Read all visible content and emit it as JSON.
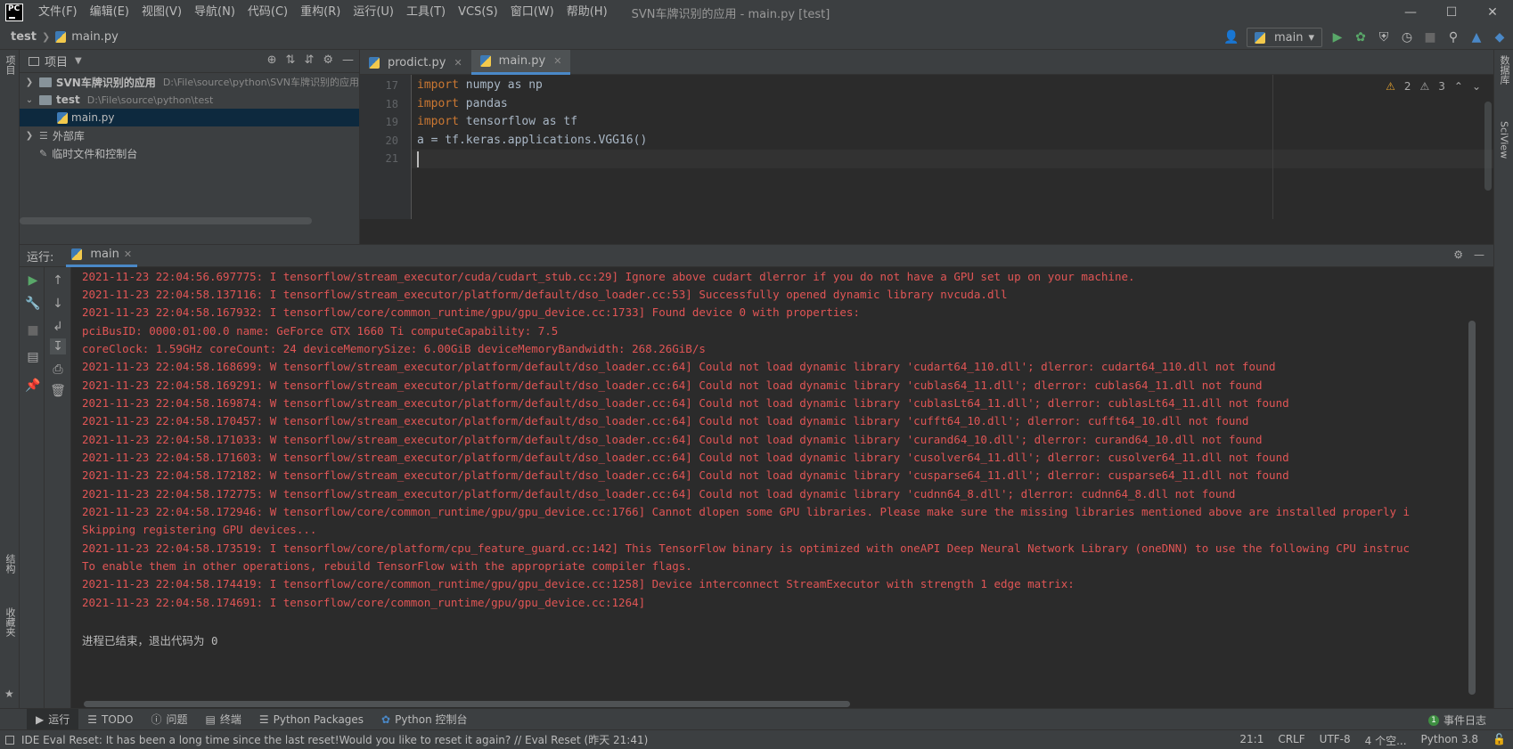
{
  "titlebar": {
    "logo": "PC",
    "menus": [
      "文件(F)",
      "编辑(E)",
      "视图(V)",
      "导航(N)",
      "代码(C)",
      "重构(R)",
      "运行(U)",
      "工具(T)",
      "VCS(S)",
      "窗口(W)",
      "帮助(H)"
    ],
    "window_title": "SVN车牌识别的应用 - main.py [test]"
  },
  "navbar": {
    "crumb_project": "test",
    "crumb_file": "main.py",
    "run_config": "main"
  },
  "left_strip": {
    "project_tab": "项目",
    "structure_tab": "结构",
    "favorites_tab": "收藏夹"
  },
  "right_strip": {
    "database_tab": "数据库",
    "sciview_tab": "SciView"
  },
  "project_panel": {
    "title": "项目",
    "tree": [
      {
        "name": "SVN车牌识别的应用",
        "path": "D:\\File\\source\\python\\SVN车牌识别的应用"
      },
      {
        "name": "test",
        "path": "D:\\File\\source\\python\\test"
      },
      {
        "name": "main.py"
      },
      {
        "name": "外部库"
      },
      {
        "name": "临时文件和控制台"
      }
    ]
  },
  "editor": {
    "tabs": [
      {
        "label": "prodict.py"
      },
      {
        "label": "main.py"
      }
    ],
    "lines": [
      {
        "num": "17",
        "kw": "import",
        "rest": " numpy as np"
      },
      {
        "num": "18",
        "kw": "import",
        "rest": " pandas"
      },
      {
        "num": "19",
        "kw": "import",
        "rest": " tensorflow as tf"
      },
      {
        "num": "20",
        "kw": "",
        "rest": "a = tf.keras.applications.VGG16()"
      },
      {
        "num": "21",
        "kw": "",
        "rest": ""
      }
    ],
    "warnings": "2",
    "weak_warnings": "3"
  },
  "run_panel": {
    "label": "运行:",
    "tab": "main"
  },
  "console": {
    "lines": [
      "2021-11-23 22:04:56.697775: I tensorflow/stream_executor/cuda/cudart_stub.cc:29] Ignore above cudart dlerror if you do not have a GPU set up on your machine.",
      "2021-11-23 22:04:58.137116: I tensorflow/stream_executor/platform/default/dso_loader.cc:53] Successfully opened dynamic library nvcuda.dll",
      "2021-11-23 22:04:58.167932: I tensorflow/core/common_runtime/gpu/gpu_device.cc:1733] Found device 0 with properties:",
      "pciBusID: 0000:01:00.0 name: GeForce GTX 1660 Ti computeCapability: 7.5",
      "coreClock: 1.59GHz coreCount: 24 deviceMemorySize: 6.00GiB deviceMemoryBandwidth: 268.26GiB/s",
      "2021-11-23 22:04:58.168699: W tensorflow/stream_executor/platform/default/dso_loader.cc:64] Could not load dynamic library 'cudart64_110.dll'; dlerror: cudart64_110.dll not found",
      "2021-11-23 22:04:58.169291: W tensorflow/stream_executor/platform/default/dso_loader.cc:64] Could not load dynamic library 'cublas64_11.dll'; dlerror: cublas64_11.dll not found",
      "2021-11-23 22:04:58.169874: W tensorflow/stream_executor/platform/default/dso_loader.cc:64] Could not load dynamic library 'cublasLt64_11.dll'; dlerror: cublasLt64_11.dll not found",
      "2021-11-23 22:04:58.170457: W tensorflow/stream_executor/platform/default/dso_loader.cc:64] Could not load dynamic library 'cufft64_10.dll'; dlerror: cufft64_10.dll not found",
      "2021-11-23 22:04:58.171033: W tensorflow/stream_executor/platform/default/dso_loader.cc:64] Could not load dynamic library 'curand64_10.dll'; dlerror: curand64_10.dll not found",
      "2021-11-23 22:04:58.171603: W tensorflow/stream_executor/platform/default/dso_loader.cc:64] Could not load dynamic library 'cusolver64_11.dll'; dlerror: cusolver64_11.dll not found",
      "2021-11-23 22:04:58.172182: W tensorflow/stream_executor/platform/default/dso_loader.cc:64] Could not load dynamic library 'cusparse64_11.dll'; dlerror: cusparse64_11.dll not found",
      "2021-11-23 22:04:58.172775: W tensorflow/stream_executor/platform/default/dso_loader.cc:64] Could not load dynamic library 'cudnn64_8.dll'; dlerror: cudnn64_8.dll not found",
      "2021-11-23 22:04:58.172946: W tensorflow/core/common_runtime/gpu/gpu_device.cc:1766] Cannot dlopen some GPU libraries. Please make sure the missing libraries mentioned above are installed properly i",
      "Skipping registering GPU devices...",
      "2021-11-23 22:04:58.173519: I tensorflow/core/platform/cpu_feature_guard.cc:142] This TensorFlow binary is optimized with oneAPI Deep Neural Network Library (oneDNN) to use the following CPU instruc",
      "To enable them in other operations, rebuild TensorFlow with the appropriate compiler flags.",
      "2021-11-23 22:04:58.174419: I tensorflow/core/common_runtime/gpu/gpu_device.cc:1258] Device interconnect StreamExecutor with strength 1 edge matrix:",
      "2021-11-23 22:04:58.174691: I tensorflow/core/common_runtime/gpu/gpu_device.cc:1264]"
    ],
    "exit_message": "进程已结束，退出代码为 0"
  },
  "bottom_tabs": {
    "run": "运行",
    "todo": "TODO",
    "problems": "问题",
    "terminal": "终端",
    "python_packages": "Python Packages",
    "python_console": "Python 控制台",
    "event_log_count": "1",
    "event_log": "事件日志"
  },
  "statusbar": {
    "message": "IDE Eval Reset: It has been a long time since the last reset!Would you like to reset it again? // Eval Reset (昨天 21:41)",
    "position": "21:1",
    "line_sep": "CRLF",
    "encoding": "UTF-8",
    "indent": "4 个空...",
    "interpreter": "Python 3.8"
  },
  "colors": {
    "console_error": "#e05555",
    "keyword": "#cc7832",
    "accent": "#4a88c7"
  }
}
